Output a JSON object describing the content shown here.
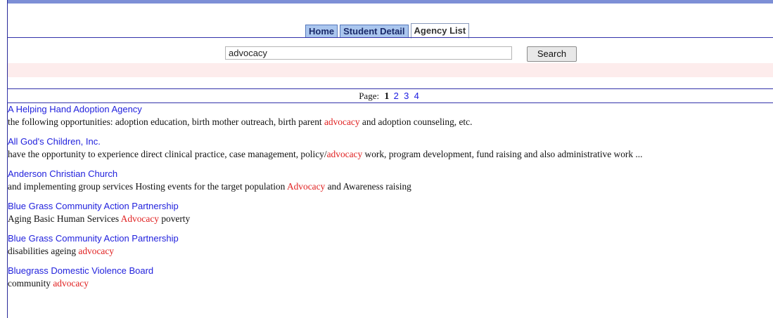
{
  "tabs": [
    {
      "label": "Home"
    },
    {
      "label": "Student Detail"
    },
    {
      "label": "Agency List"
    }
  ],
  "search": {
    "value": "advocacy",
    "button_label": "Search"
  },
  "pager": {
    "label": "Page:",
    "current": "1",
    "pages": [
      "2",
      "3",
      "4"
    ]
  },
  "highlight_color": "#e02020",
  "link_color": "#2222dd",
  "results": [
    {
      "title": "A Helping Hand Adoption Agency",
      "before": "the following opportunities: adoption education, birth mother outreach, birth parent ",
      "highlight": "advocacy",
      "after": " and adoption counseling, etc."
    },
    {
      "title": "All God's Children, Inc.",
      "before": "have the opportunity to experience direct clinical practice, case management, policy/",
      "highlight": "advocacy",
      "after": " work, program development, fund raising and also administrative work ..."
    },
    {
      "title": "Anderson Christian Church",
      "before": "and implementing group services Hosting events for the target population ",
      "highlight": "Advocacy",
      "after": " and Awareness raising"
    },
    {
      "title": "Blue Grass Community Action Partnership",
      "before": "Aging Basic Human Services ",
      "highlight": "Advocacy",
      "after": " poverty"
    },
    {
      "title": "Blue Grass Community Action Partnership",
      "before": "disabilities ageing ",
      "highlight": "advocacy",
      "after": ""
    },
    {
      "title": "Bluegrass Domestic Violence Board",
      "before": "community ",
      "highlight": "advocacy",
      "after": ""
    }
  ]
}
